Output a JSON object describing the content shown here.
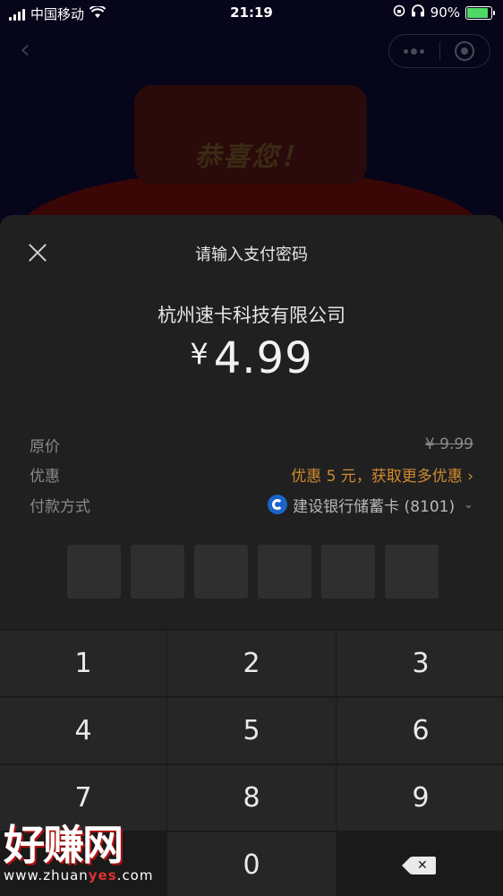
{
  "status_bar": {
    "carrier": "中国移动",
    "time": "21:19",
    "battery": "90%"
  },
  "background_app": {
    "congrats_text": "恭喜您！"
  },
  "sheet": {
    "title": "请输入支付密码",
    "merchant": "杭州速卡科技有限公司",
    "currency_symbol": "¥",
    "amount": "4.99"
  },
  "details": {
    "original_label": "原价",
    "original_value": "¥ 9.99",
    "discount_label": "优惠",
    "discount_value": "优惠 5 元，获取更多优惠 ›",
    "payment_label": "付款方式",
    "payment_value": "建设银行储蓄卡 (8101)"
  },
  "pin": {
    "length": 6,
    "entered": 0
  },
  "keypad": {
    "keys": [
      "1",
      "2",
      "3",
      "4",
      "5",
      "6",
      "7",
      "8",
      "9",
      "",
      "0",
      "delete"
    ]
  },
  "watermark": {
    "main": "好赚网",
    "sub_prefix": "www.zhuan",
    "sub_highlight": "yes",
    "sub_suffix": ".com"
  },
  "colors": {
    "sheet_bg": "#202020",
    "promo": "#d08a2e",
    "bank_blue": "#1d64c8"
  }
}
